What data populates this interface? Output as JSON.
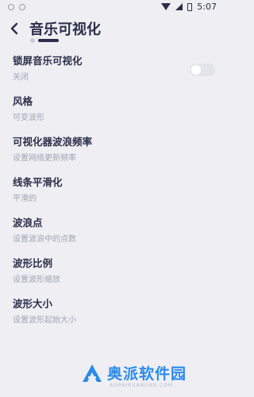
{
  "status_bar": {
    "time": "5:07"
  },
  "header": {
    "title": "音乐可视化"
  },
  "settings": [
    {
      "label": "锁屏音乐可视化",
      "sub": "关闭"
    },
    {
      "label": "风格",
      "sub": "可变波形"
    },
    {
      "label": "可视化器波浪频率",
      "sub": "设置网络更新频率"
    },
    {
      "label": "线条平滑化",
      "sub": "平滑的"
    },
    {
      "label": "波浪点",
      "sub": "设置波浪中的点数"
    },
    {
      "label": "波形比例",
      "sub": "设置波形缩放"
    },
    {
      "label": "波形大小",
      "sub": "设置波形起始大小"
    }
  ],
  "toggle": {
    "state": "off"
  },
  "watermark": {
    "name": "奥派软件园",
    "domain": "AOPAIRUANJIAN.COM"
  },
  "colors": {
    "text": "#2b2f4a",
    "subtext": "#a2a5b3",
    "background": "#eeeef3",
    "brand": "#2c8be8"
  }
}
